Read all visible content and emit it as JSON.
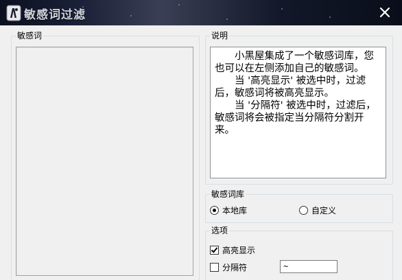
{
  "window": {
    "title": "敏感词过滤",
    "close_label": "✕"
  },
  "sensitive_words": {
    "group_label": "敏感词",
    "items": []
  },
  "description": {
    "group_label": "说明",
    "text": "　　小黑屋集成了一个敏感词库，您也可以在左侧添加自己的敏感词。\n　　当 '高亮显示' 被选中时，过滤后，敏感词将被高亮显示。\n　　当 '分隔符' 被选中时，过滤后， 敏感词将会被指定当分隔符分割开来。"
  },
  "library": {
    "group_label": "敏感词库",
    "options": [
      {
        "label": "本地库",
        "selected": true
      },
      {
        "label": "自定义",
        "selected": false
      }
    ]
  },
  "options": {
    "group_label": "选项",
    "highlight_label": "高亮显示",
    "highlight_checked": true,
    "separator_label": "分隔符",
    "separator_checked": false,
    "separator_value": "~"
  }
}
